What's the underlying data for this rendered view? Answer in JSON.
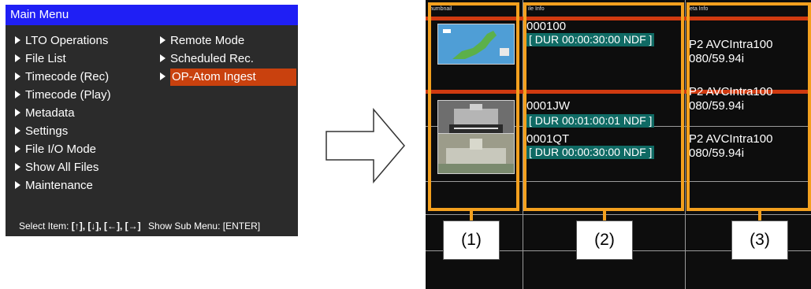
{
  "main_menu": {
    "title": "Main Menu",
    "left_items": [
      {
        "label": "LTO Operations"
      },
      {
        "label": "File List"
      },
      {
        "label": "Timecode (Rec)"
      },
      {
        "label": "Timecode (Play)"
      },
      {
        "label": "Metadata"
      },
      {
        "label": "Settings"
      },
      {
        "label": "File I/O Mode"
      },
      {
        "label": "Show All Files"
      },
      {
        "label": "Maintenance"
      }
    ],
    "right_items": [
      {
        "label": "Remote Mode"
      },
      {
        "label": "Scheduled Rec."
      },
      {
        "label": "OP-Atom Ingest",
        "selected": true
      }
    ],
    "hint": {
      "select_label": "Select Item:",
      "select_keys": "[↑], [↓], [←], [→]",
      "submenu_label": "Show Sub Menu: [ENTER]"
    }
  },
  "clip_list": {
    "headers": {
      "thumbnail": "humbnail",
      "file_info": "ile Info",
      "meta_info": "eta Info"
    },
    "rows": [
      {
        "name": "000100",
        "duration": "[ DUR 00:00:30:00 NDF ]",
        "meta_line1": "P2 AVCIntra100",
        "meta_line2": "080/59.94i",
        "thumb_icon": "weather-map-thumbnail"
      },
      {
        "name": "0001JW",
        "duration": "[ DUR 00:01:00:01 NDF ]",
        "meta_line1": "P2 AVCIntra100",
        "meta_line2": "080/59.94i",
        "thumb_icon": "news-building-thumbnail"
      },
      {
        "name": "0001QT",
        "duration": "[ DUR 00:00:30:00 NDF ]",
        "meta_line1": "P2 AVCIntra100",
        "meta_line2": "080/59.94i",
        "thumb_icon": "parliament-building-thumbnail"
      }
    ]
  },
  "callouts": {
    "c1": "(1)",
    "c2": "(2)",
    "c3": "(3)"
  },
  "colors": {
    "menu_title_bg": "#1f1ff5",
    "selected_bg": "#c9410e",
    "callout_orange": "#f3a01e",
    "duration_bg": "#0f6a64",
    "separator_red": "#d03a10"
  }
}
